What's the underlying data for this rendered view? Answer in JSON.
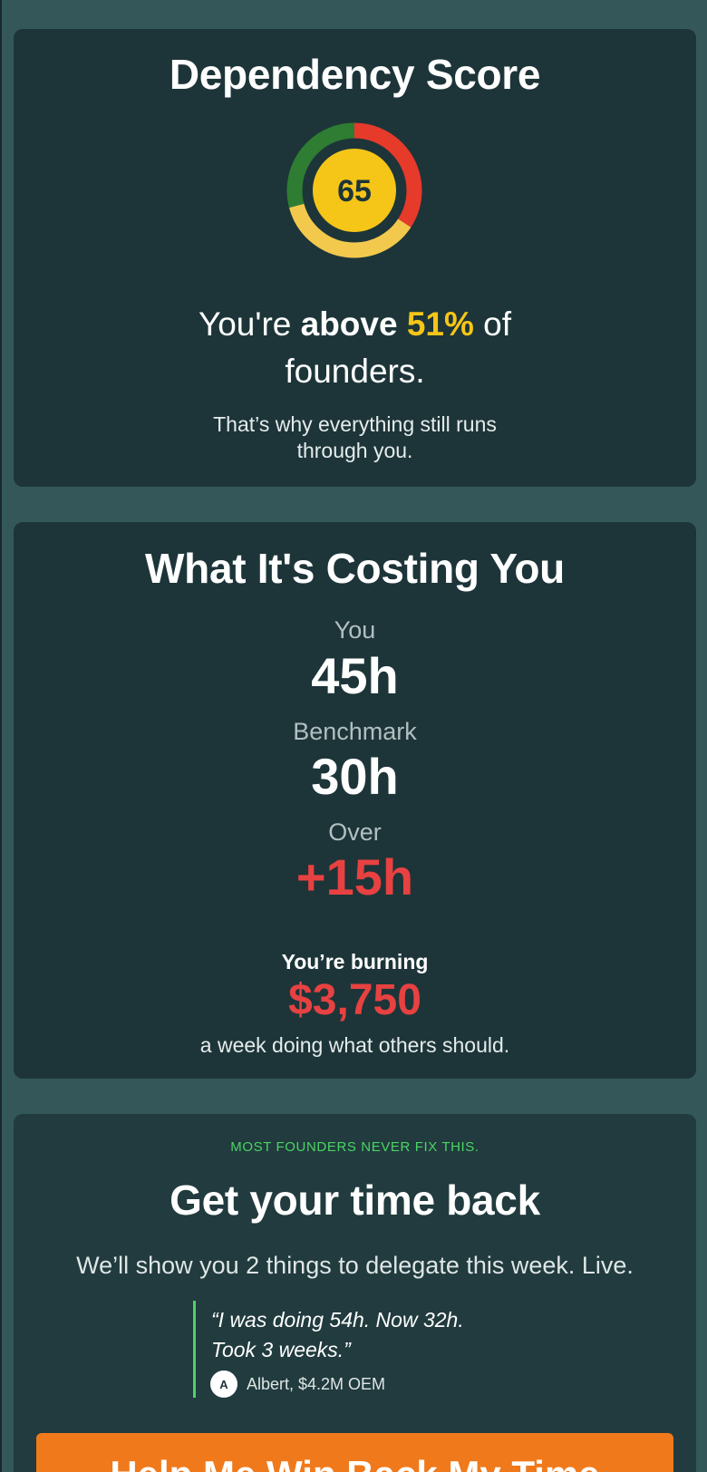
{
  "score_card": {
    "title": "Dependency Score",
    "score": "65",
    "gauge_colors": {
      "green": "#2e7d32",
      "red": "#e63a2b",
      "yellow": "#f2c94c",
      "center": "#f5c518"
    },
    "comparison_prefix": "You're ",
    "comparison_bold": "above",
    "comparison_percent": "51%",
    "comparison_suffix": " of founders.",
    "subtext": "That’s why everything still runs through you."
  },
  "cost_card": {
    "title": "What It's Costing You",
    "metrics": [
      {
        "label": "You",
        "value": "45h"
      },
      {
        "label": "Benchmark",
        "value": "30h"
      },
      {
        "label": "Over",
        "value": "+15h"
      }
    ],
    "burn_label": "You’re burning",
    "burn_value": "$3,750",
    "burn_sub": "a week doing what others should."
  },
  "cta_card": {
    "kicker": "MOST FOUNDERS NEVER FIX THIS.",
    "title": "Get your time back",
    "description": "We’ll show you 2 things to delegate this week. Live.",
    "quote_line1": "“I was doing 54h. Now 32h.",
    "quote_line2": "Took 3 weeks.”",
    "avatar_initial": "A",
    "author": "Albert, $4.2M OEM",
    "button_label": "Help Me Win Back My Time"
  },
  "colors": {
    "background": "#345859",
    "card": "#1d3539",
    "accent_red": "#e84141",
    "accent_yellow": "#f5c518",
    "accent_green": "#4cd464",
    "button": "#f0791b"
  }
}
